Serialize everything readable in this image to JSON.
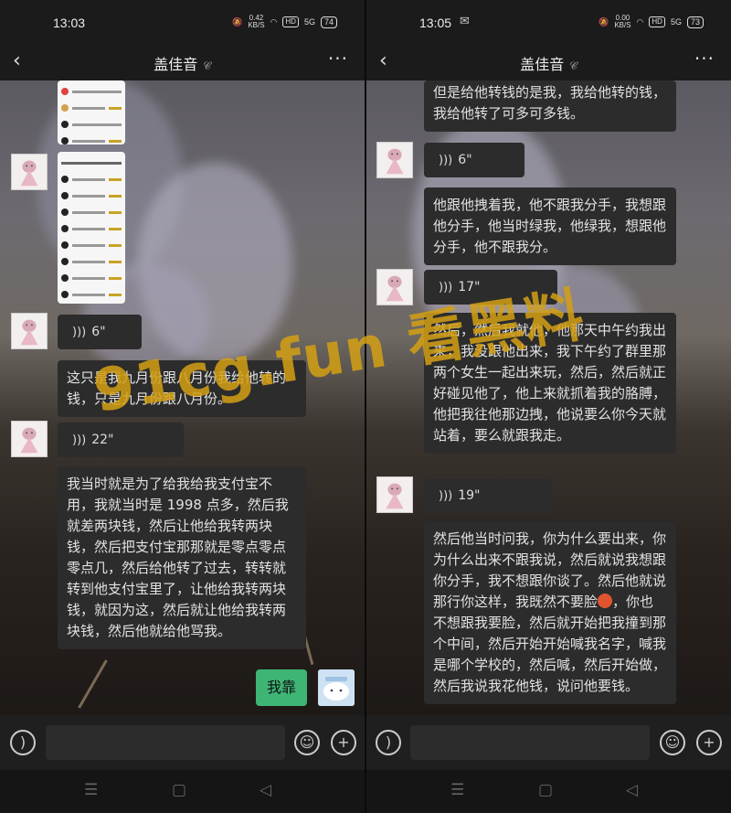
{
  "left": {
    "status": {
      "time": "13:03",
      "net_speed": "0.42",
      "net_unit": "KB/S",
      "hd": "HD",
      "signal": "5G",
      "battery": "74"
    },
    "contact_name": "盖佳音",
    "messages": [
      {
        "type": "voice",
        "duration": "6\""
      },
      {
        "type": "text",
        "text": "这只是我九月份跟八月份我给他转的钱，只是九月份跟八月份。"
      },
      {
        "type": "voice",
        "duration": "22\""
      },
      {
        "type": "text",
        "text": "我当时就是为了给我给我支付宝不用，我就当时是 1998 点多，然后我就差两块钱，然后让他给我转两块钱，然后把支付宝那那就是零点零点零点几，然后给他转了过去，转转就转到他支付宝里了，让他给我转两块钱，就因为这，然后就让他给我转两块钱，然后他就给他骂我。"
      },
      {
        "type": "text_self",
        "text": "我靠"
      }
    ]
  },
  "right": {
    "status": {
      "time": "13:05",
      "net_speed": "0.00",
      "net_unit": "KB/S",
      "hd": "HD",
      "signal": "5G",
      "battery": "73"
    },
    "contact_name": "盖佳音",
    "messages": [
      {
        "type": "text",
        "text": "但是给他转钱的是我，我给他转的钱，我给他转了可多可多钱。"
      },
      {
        "type": "voice",
        "duration": "6\""
      },
      {
        "type": "text",
        "text": "他跟他拽着我，他不跟我分手，我想跟他分手，他当时绿我，他绿我，想跟他分手，他不跟我分。"
      },
      {
        "type": "voice",
        "duration": "17\""
      },
      {
        "type": "text",
        "text": "然后，然后我就他，他那天中午约我出来，我没跟他出来，我下午约了群里那两个女生一起出来玩，然后，然后就正好碰见他了，他上来就抓着我的胳膊，他把我往他那边拽，他说要么你今天就站着，要么就跟我走。"
      },
      {
        "type": "voice",
        "duration": "19\""
      },
      {
        "type": "text_a",
        "text": "然后他当时问我，你为什么要出来，你为什么出来不跟我说，然后就说我想跟你分手，我不想跟你谈了。然后他就说那行你这样，我既然不要脸"
      },
      {
        "type": "text_b",
        "text": "，你也不想跟我要脸，然后就开始把我撞到那个中间，然后开始开始喊我名字，喊我是哪个学校的，然后喊，然后开始做，然后我说我花他钱，说问他要钱。"
      }
    ]
  },
  "watermark": "91cg.fun 看黑料"
}
